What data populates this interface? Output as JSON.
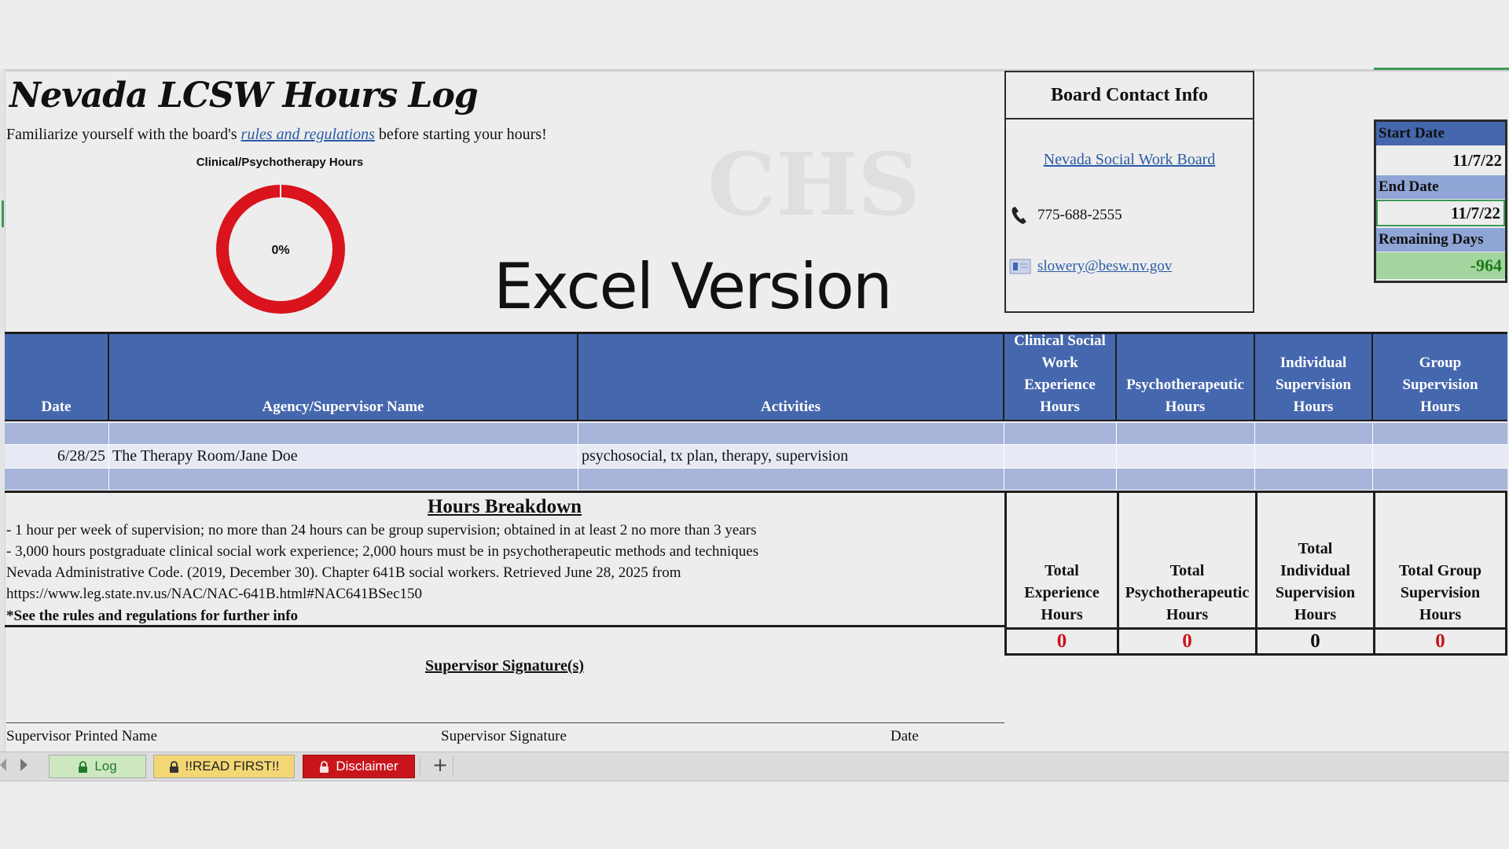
{
  "sheet": {
    "title": "Nevada LCSW Hours Log",
    "intro_before": "Familiarize yourself with the board's ",
    "intro_link": "rules and regulations",
    "intro_after": " before starting your hours!",
    "donut_title": "Clinical/Psychotherapy Hours",
    "donut_value": "0%",
    "donut_fraction": 0,
    "version_label": "Excel Version",
    "watermark": "CHS"
  },
  "board": {
    "title": "Board Contact Info",
    "link": "Nevada Social Work Board",
    "phone": "775-688-2555",
    "email": "slowery@besw.nv.gov"
  },
  "dates": {
    "start_label": "Start Date",
    "start_value": "11/7/22",
    "end_label": "End Date",
    "end_value": "11/7/22",
    "remaining_label": "Remaining Days",
    "remaining_value": "-964"
  },
  "table": {
    "headers": {
      "date": "Date",
      "agency": "Agency/Supervisor Name",
      "activities": "Activities",
      "clinical": "Clinical Social Work Experience Hours",
      "psycho": "Psychotherapeutic Hours",
      "individual": "Individual Supervision Hours",
      "group": "Group Supervision Hours"
    },
    "rows": [
      {
        "date": "",
        "agency": "",
        "activities": ""
      },
      {
        "date": "6/28/25",
        "agency": "The Therapy Room/Jane Doe",
        "activities": "psychosocial, tx plan, therapy, supervision"
      },
      {
        "date": "",
        "agency": "",
        "activities": ""
      }
    ]
  },
  "breakdown": {
    "title": "Hours Breakdown",
    "lines": [
      "- 1 hour per week of supervision; no more than 24 hours can be group supervision; obtained in at least 2 no more than 3 years",
      "- 3,000 hours postgraduate clinical social work experience; 2,000 hours must be in psychotherapeutic methods and techniques",
      "Nevada Administrative Code. (2019, December 30). Chapter 641B social workers. Retrieved June 28, 2025 from",
      "https://www.leg.state.nv.us/NAC/NAC-641B.html#NAC641BSec150"
    ],
    "note": "*See the rules and regulations for further info"
  },
  "totals": {
    "experience_label": "Total Experience Hours",
    "psycho_label": "Total Psychotherapeutic Hours",
    "individual_label": "Total Individual Supervision Hours",
    "group_label": "Total Group Supervision Hours",
    "experience_value": "0",
    "psycho_value": "0",
    "individual_value": "0",
    "group_value": "0"
  },
  "signature": {
    "title": "Supervisor Signature(s)",
    "printed_name": "Supervisor Printed Name",
    "signature": "Supervisor Signature",
    "date": "Date"
  },
  "tabs": {
    "log": "Log",
    "read_first": "!!READ FIRST!!",
    "disclaimer": "Disclaimer",
    "add": "+"
  },
  "colors": {
    "header_blue": "#4567ad",
    "band_blue": "#a7b5da",
    "donut_red": "#d9141c",
    "total_red": "#c8151b",
    "remaining_green": "#a3d69e"
  },
  "icons": [
    "phone-icon",
    "email-icon",
    "lock-icon",
    "scroll-left-icon",
    "scroll-right-icon"
  ]
}
